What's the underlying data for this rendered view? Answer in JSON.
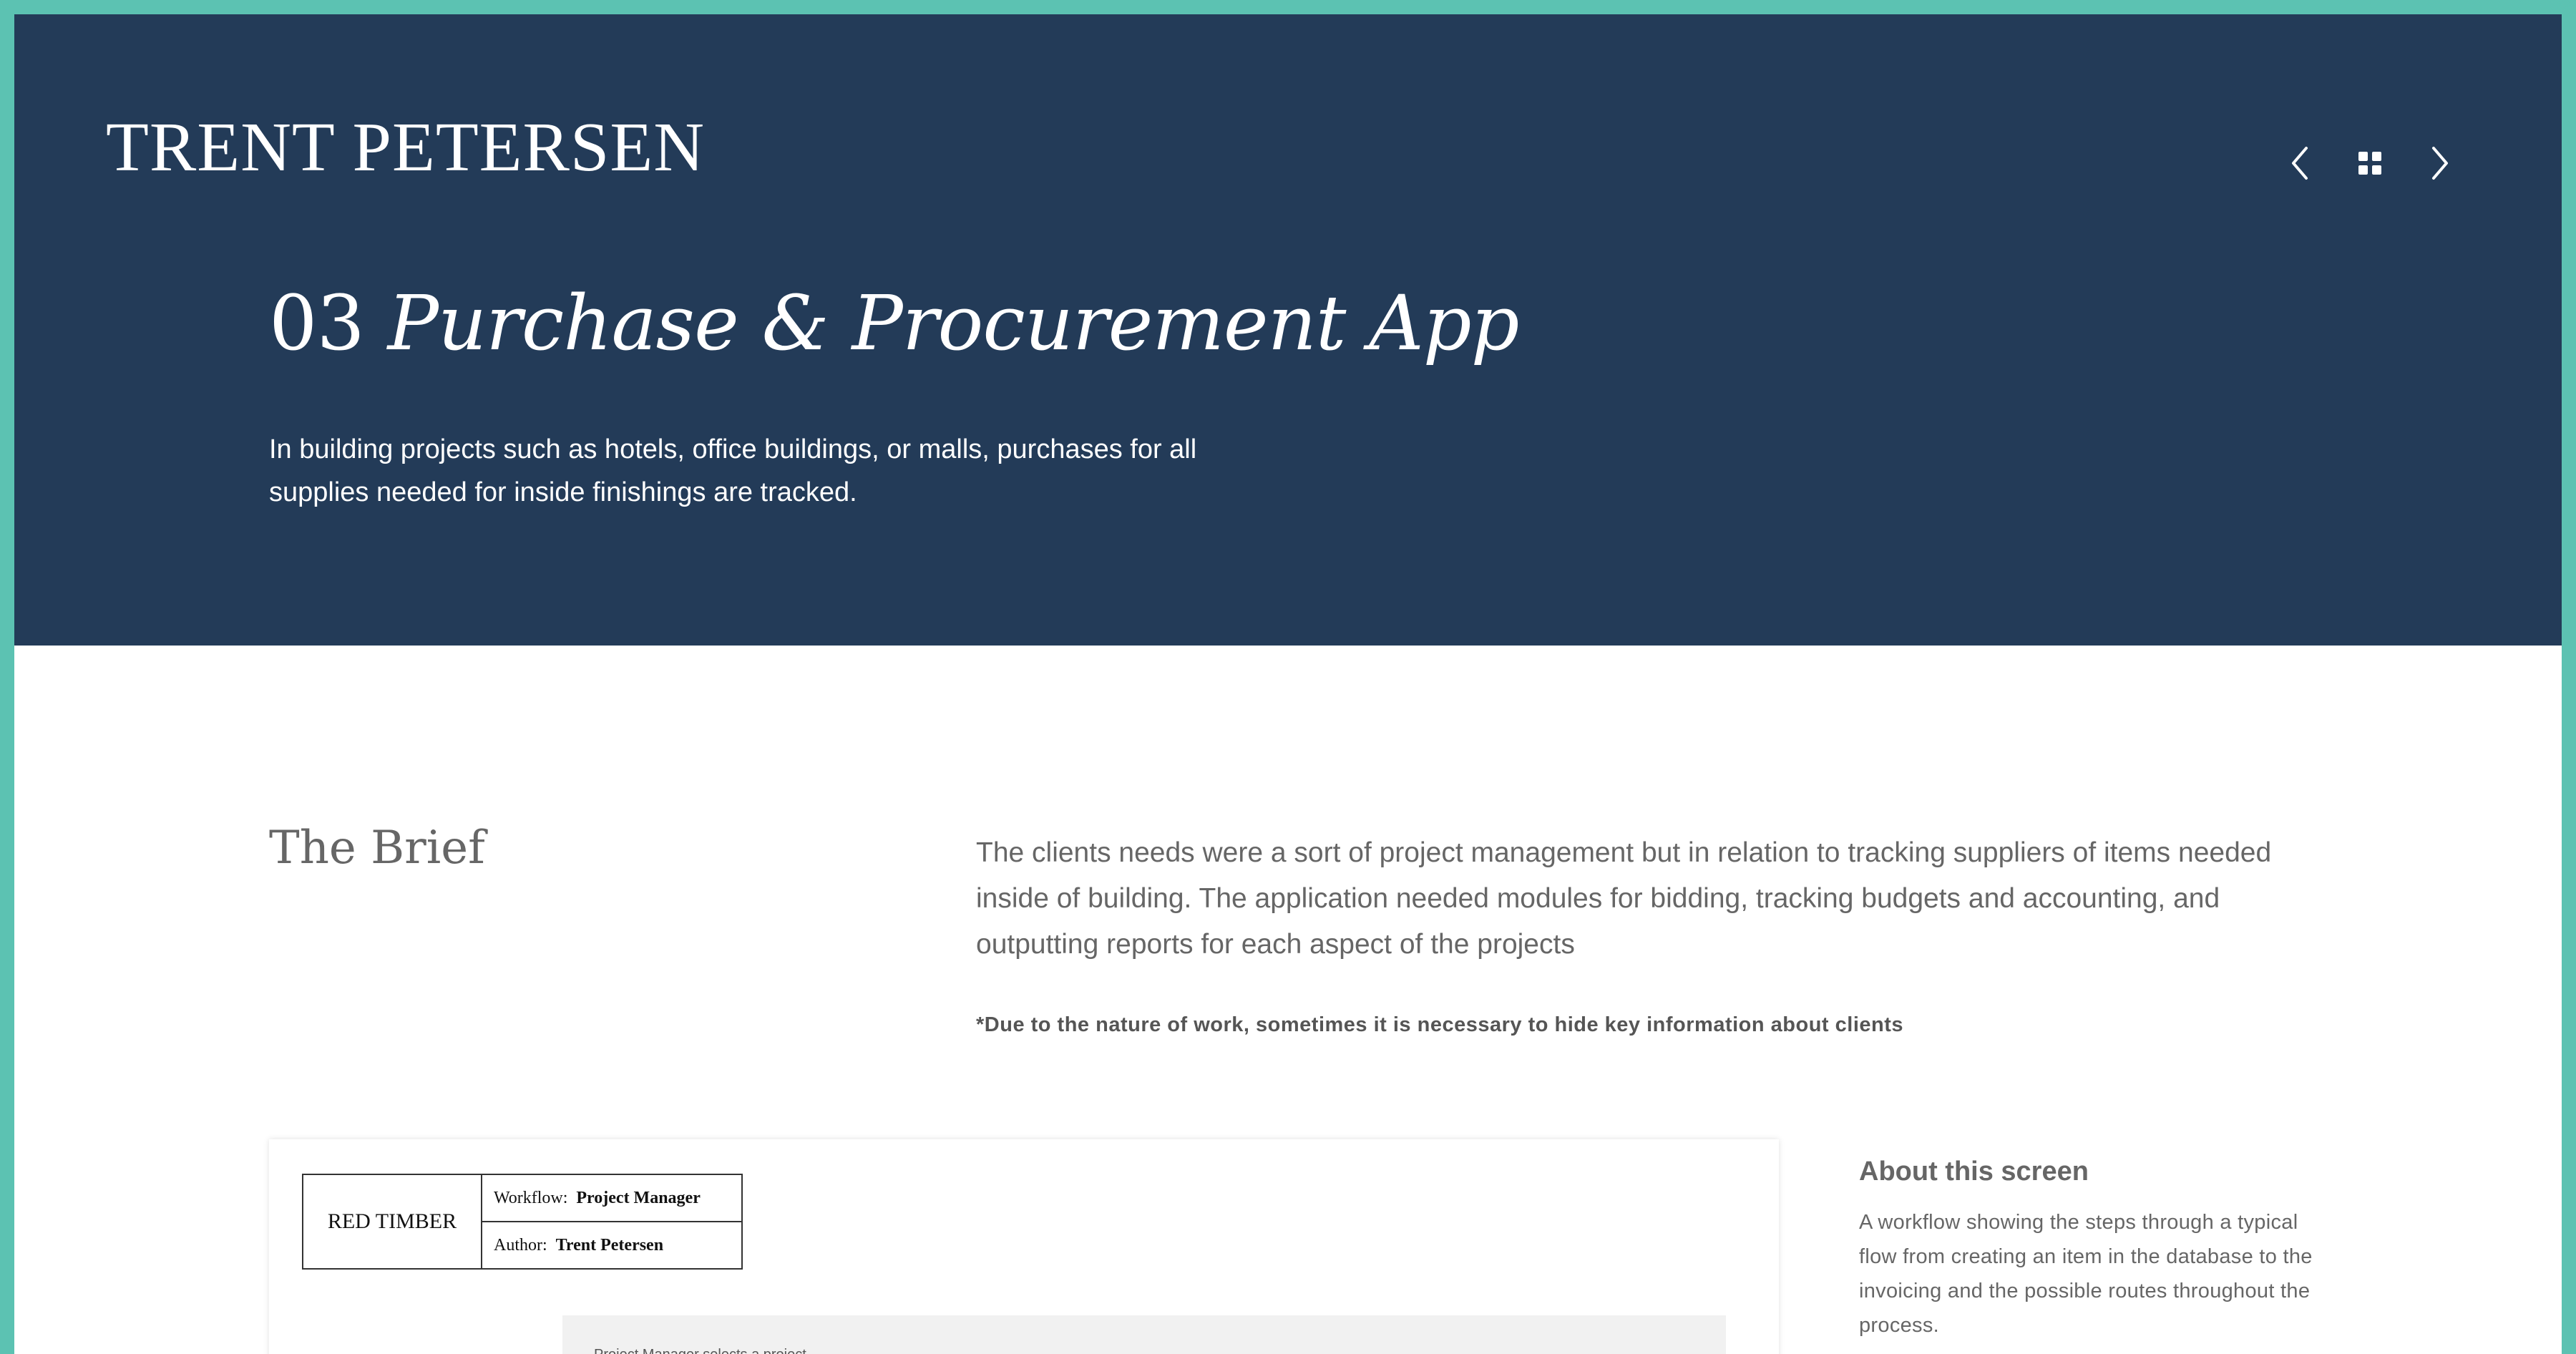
{
  "header": {
    "logo": "TRENT PETERSEN",
    "nav": {
      "prev_icon": "chevron-left-icon",
      "grid_icon": "grid-icon",
      "next_icon": "chevron-right-icon"
    }
  },
  "hero": {
    "number": "03",
    "title": "Purchase & Procurement App",
    "description": "In building projects such as hotels, office buildings, or malls, purchases for all supplies needed for inside finishings are tracked."
  },
  "brief": {
    "title": "The Brief",
    "text": "The clients needs were a sort of project management but in relation to tracking suppliers of items needed inside of building. The application needed modules for bidding, tracking budgets and accounting, and outputting reports for each aspect of the projects",
    "note": "*Due to the nature of work, sometimes it is necessary to hide key information about clients"
  },
  "document": {
    "company": "RED TIMBER",
    "workflow_label": "Workflow:",
    "workflow_value": "Project Manager",
    "author_label": "Author:",
    "author_value": "Trent Petersen",
    "first_step": "Project Manager selects a project"
  },
  "about": {
    "title": "About this screen",
    "text": "A workflow showing the steps through a typical flow from creating an item in the database to the invoicing and the possible routes throughout the process."
  },
  "colors": {
    "border_accent": "#5cc2b2",
    "hero_bg": "#233b58",
    "text_gray": "#666666"
  }
}
